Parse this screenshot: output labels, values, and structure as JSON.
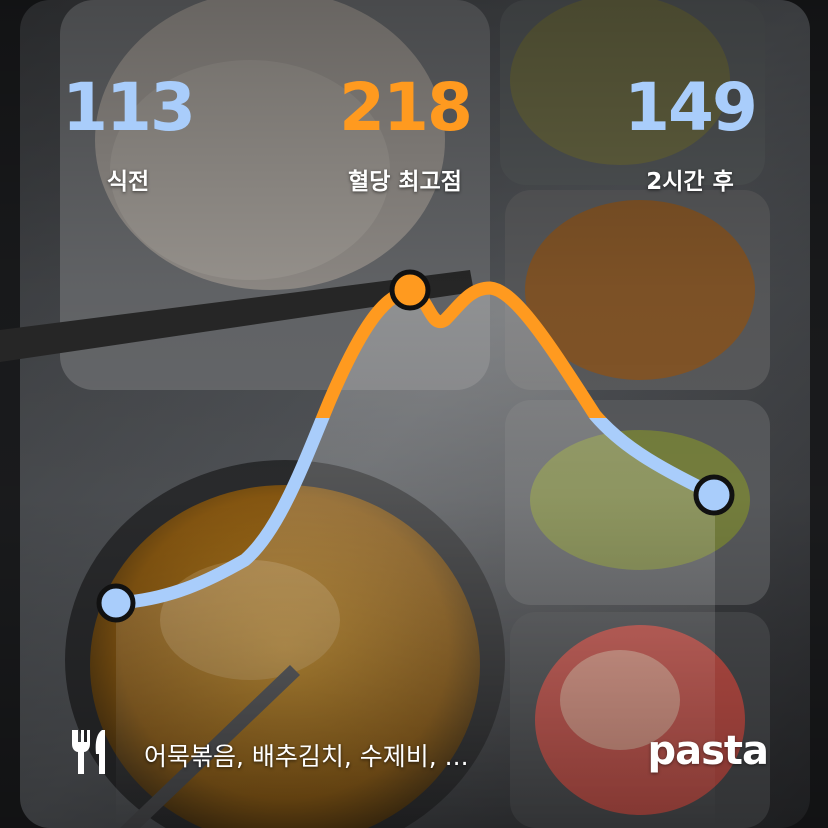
{
  "stats": {
    "before": {
      "value": "113",
      "label": "식전"
    },
    "peak": {
      "value": "218",
      "label": "혈당 최고점"
    },
    "after": {
      "value": "149",
      "label": "2시간 후"
    }
  },
  "colors": {
    "below_line": "#a9cdfb",
    "above_line": "#ff9a1f",
    "marker_outline": "#111111"
  },
  "food_list": "어묵볶음, 배추김치, 수제비, ...",
  "brand": "pasta",
  "icons": {
    "meal": "fork-knife-icon"
  }
}
